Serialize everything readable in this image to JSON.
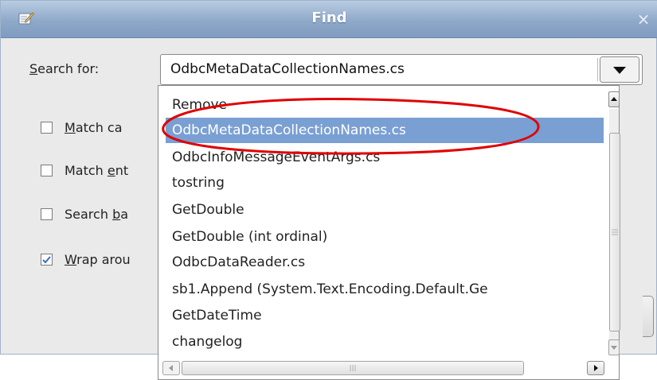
{
  "window": {
    "title": "Find",
    "close_glyph": "×"
  },
  "search": {
    "label_mnemonic": "S",
    "label_rest": "earch for:",
    "value": "OdbcMetaDataCollectionNames.cs"
  },
  "options": [
    {
      "pre": "",
      "mnemonic": "M",
      "post": "atch ca",
      "checked": false
    },
    {
      "pre": "Match ",
      "mnemonic": "e",
      "post": "nt",
      "checked": false
    },
    {
      "pre": "Search ",
      "mnemonic": "b",
      "post": "a",
      "checked": false
    },
    {
      "pre": "",
      "mnemonic": "W",
      "post": "rap arou",
      "checked": true
    }
  ],
  "history": {
    "items": [
      "Remove",
      "OdbcMetaDataCollectionNames.cs",
      "OdbcInfoMessageEventArgs.cs",
      "tostring",
      "GetDouble",
      "GetDouble (int ordinal)",
      "OdbcDataReader.cs",
      "sb1.Append (System.Text.Encoding.Default.Ge",
      "GetDateTime",
      "changelog"
    ],
    "selected_index": 1
  },
  "colors": {
    "selection": "#7a9fd3",
    "titlebar": "#8fa9c9",
    "annotation": "#e00000",
    "check": "#3a6fc4"
  },
  "icons": {
    "title": "edit-icon",
    "close": "close-icon",
    "dropdown": "triangle-down-icon"
  }
}
